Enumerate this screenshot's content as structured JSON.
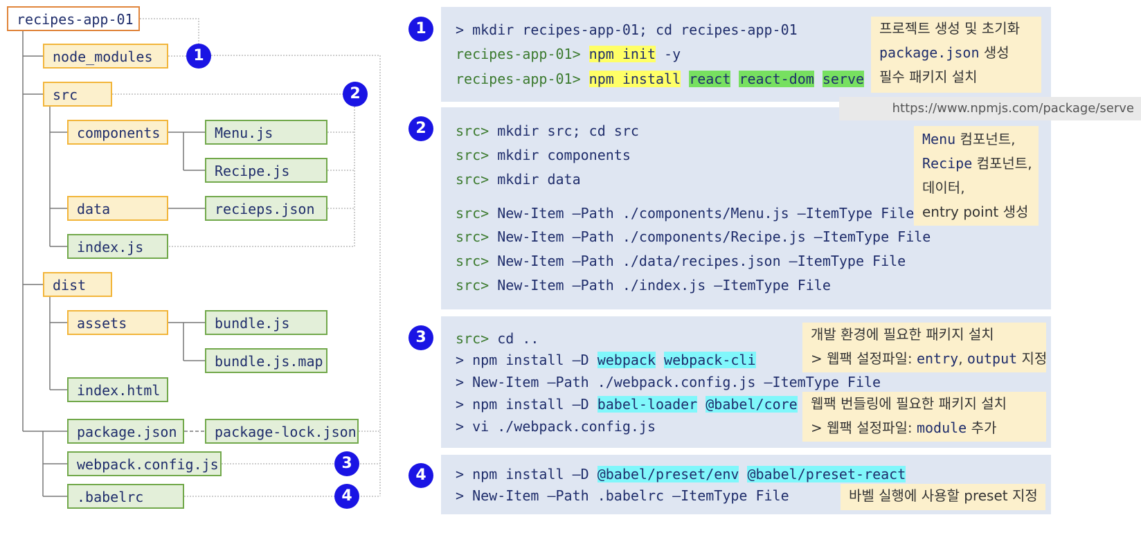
{
  "tree": {
    "root": "recipes-app-01",
    "node_modules": "node_modules",
    "src": "src",
    "components": "components",
    "menu_js": "Menu.js",
    "recipe_js": "Recipe.js",
    "data": "data",
    "recipes_json": "recieps.json",
    "index_js": "index.js",
    "dist": "dist",
    "assets": "assets",
    "bundle_js": "bundle.js",
    "bundle_map": "bundle.js.map",
    "index_html": "index.html",
    "package_json": "package.json",
    "package_lock": "package-lock.json",
    "webpack_config": "webpack.config.js",
    "babelrc": ".babelrc"
  },
  "badges": [
    "1",
    "2",
    "3",
    "4"
  ],
  "step1": {
    "line1": "> mkdir recipes-app-01; cd recipes-app-01",
    "prompt": "recipes-app-01>",
    "npm_init": "npm init",
    "y_flag": " -y",
    "npm_install": "npm install",
    "pkg_react": "react",
    "pkg_react_dom": "react-dom",
    "pkg_serve": "serve",
    "note1": "프로젝트 생성 및 초기화",
    "note2_code": "package.json",
    "note2_text": " 생성",
    "note3": "필수 패키지 설치",
    "url": "https://www.npmjs.com/package/serve"
  },
  "step2": {
    "prompt": "src>",
    "c1": " mkdir src; cd src",
    "c2": " mkdir components",
    "c3": " mkdir data",
    "c4": " New-Item –Path ./components/Menu.js –ItemType File",
    "c5": " New-Item –Path ./components/Recipe.js –ItemType File",
    "c6": " New-Item –Path ./data/recipes.json –ItemType File",
    "c7": " New-Item –Path ./index.js –ItemType File",
    "note_menu": "Menu",
    "note_component1": " 컴포넌트,",
    "note_recipe": "Recipe",
    "note_component2": " 컴포넌트,",
    "note_data": "데이터,",
    "note_entry": "entry point 생성"
  },
  "step3": {
    "prompt": "src>",
    "c1": " cd ..",
    "c2a": "> npm install –D ",
    "pkg_webpack": "webpack",
    "pkg_webpack_cli": "webpack-cli",
    "c3": "> New-Item –Path ./webpack.config.js –ItemType File",
    "c4a": "> npm install –D ",
    "pkg_babel_loader": "babel-loader",
    "pkg_babel_core": "@babel/core",
    "c5": "> vi ./webpack.config.js",
    "note_a1": "개발 환경에 필요한 패키지 설치",
    "note_a2_pre": "> 웹팩 설정파일: ",
    "note_a2_entry": "entry",
    "note_a2_comma": ", ",
    "note_a2_output": "output",
    "note_a2_post": " 지정",
    "note_b1": "웹팩 번들링에 필요한 패키지 설치",
    "note_b2_pre": "> 웹팩 설정파일: ",
    "note_b2_module": "module",
    "note_b2_post": "  추가"
  },
  "step4": {
    "c1a": "> npm install –D ",
    "pkg_preset_env": "@babel/preset/env",
    "pkg_preset_react": "@babel/preset-react",
    "c2": "> New-Item –Path .babelrc –ItemType File",
    "note": "바벨 실행에 사용할 preset 지정"
  },
  "colors": {
    "badge": "#1a14e4",
    "folder_fill": "#fcf0cc",
    "folder_border": "#f2b53a",
    "file_fill": "#e3efd9",
    "file_border": "#71a84a",
    "panel": "#dfe6f2",
    "highlight_yellow": "#ffff66",
    "highlight_green": "#77e060",
    "highlight_cyan": "#80f7fb"
  }
}
